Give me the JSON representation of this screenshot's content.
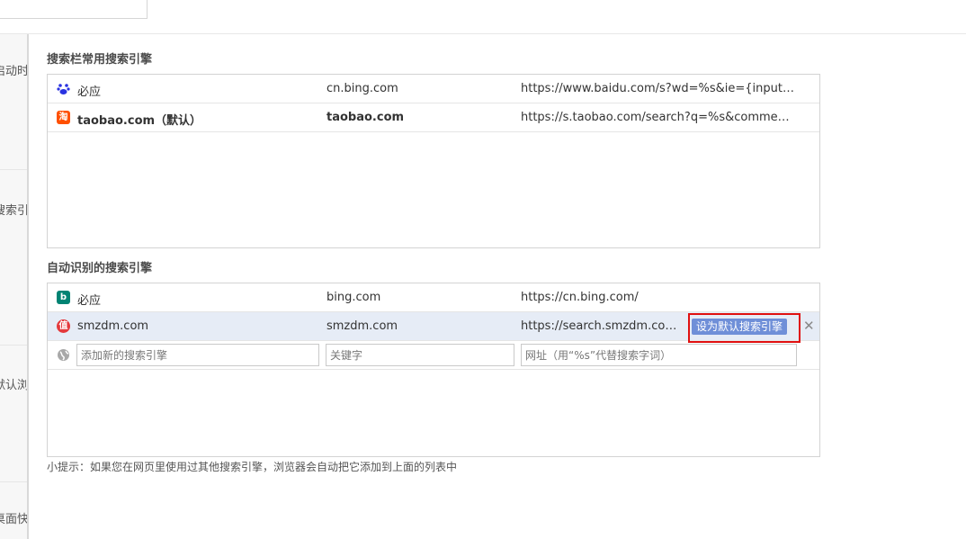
{
  "nav": {
    "items": [
      {
        "label": "启动时"
      },
      {
        "label": "搜索引"
      },
      {
        "label": "默认浏"
      },
      {
        "label": "桌面快"
      }
    ]
  },
  "common": {
    "title": "搜索栏常用搜索引擎",
    "rows": [
      {
        "icon": "baidu-paw-icon",
        "name": "必应",
        "keyword": "cn.bing.com",
        "url": "https://www.baidu.com/s?wd=%s&ie={inputEncoding}"
      },
      {
        "icon": "taobao-icon",
        "name": "taobao.com（默认）",
        "keyword": "taobao.com",
        "url": "https://s.taobao.com/search?q=%s&commend=all"
      }
    ]
  },
  "auto": {
    "title": "自动识别的搜索引擎",
    "rows": [
      {
        "icon": "bing-icon",
        "name": "必应",
        "keyword": "bing.com",
        "url": "https://cn.bing.com/"
      },
      {
        "icon": "smzdm-icon",
        "name": "smzdm.com",
        "keyword": "smzdm.com",
        "url": "https://search.smzdm.com/..."
      }
    ],
    "set_default_label": "设为默认搜索引擎",
    "delete_label": "✕",
    "new_row": {
      "name_placeholder": "添加新的搜索引擎",
      "keyword_placeholder": "关键字",
      "url_placeholder": "网址（用“%s”代替搜索字词）"
    }
  },
  "hint": "小提示：如果您在网页里使用过其他搜索引擎，浏览器会自动把它添加到上面的列表中",
  "colors": {
    "highlight_row": "#e6ecf6",
    "button": "#6f8fd8",
    "red_frame": "#e01010"
  }
}
